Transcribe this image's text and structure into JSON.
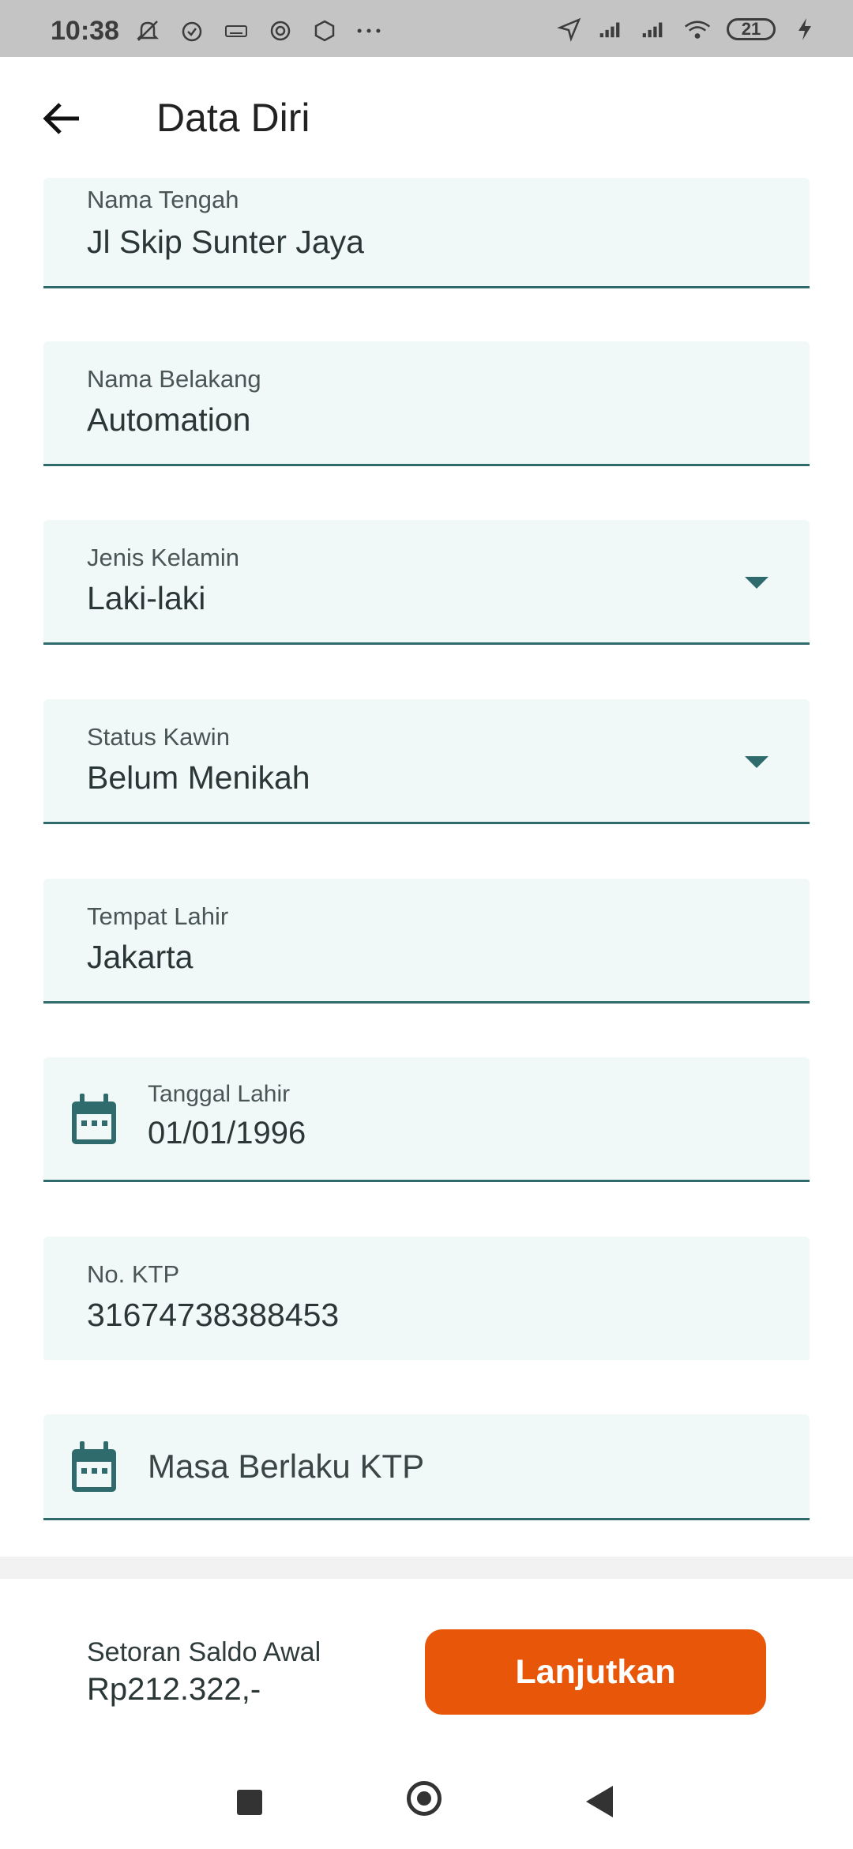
{
  "status_bar": {
    "time": "10:38",
    "battery": "21",
    "left_icons": [
      "mute-icon",
      "alarm-icon",
      "keyboard-icon",
      "settings-icon",
      "app-icon",
      "more-icon"
    ],
    "right_icons": [
      "location-icon",
      "signal-icon",
      "signal-icon",
      "wifi-icon",
      "battery-icon",
      "charging-icon"
    ]
  },
  "header": {
    "title": "Data Diri"
  },
  "form": {
    "nama_tengah": {
      "label": "Nama Tengah",
      "value": "Jl Skip Sunter Jaya"
    },
    "nama_belakang": {
      "label": "Nama Belakang",
      "value": "Automation"
    },
    "jenis_kelamin": {
      "label": "Jenis Kelamin",
      "value": "Laki-laki"
    },
    "status_kawin": {
      "label": "Status Kawin",
      "value": "Belum Menikah"
    },
    "tempat_lahir": {
      "label": "Tempat Lahir",
      "value": "Jakarta"
    },
    "tanggal_lahir": {
      "label": "Tanggal Lahir",
      "value": "01/01/1996"
    },
    "no_ktp": {
      "label": "No. KTP",
      "value": "31674738388453"
    },
    "masa_berlaku_ktp": {
      "placeholder": "Masa Berlaku KTP"
    }
  },
  "footer": {
    "saldo_label": "Setoran Saldo Awal",
    "saldo_value": "Rp212.322,-",
    "next_button": "Lanjutkan"
  },
  "colors": {
    "accent": "#2f6b6d",
    "field_bg": "#f1f9f8",
    "button": "#e8560a"
  }
}
